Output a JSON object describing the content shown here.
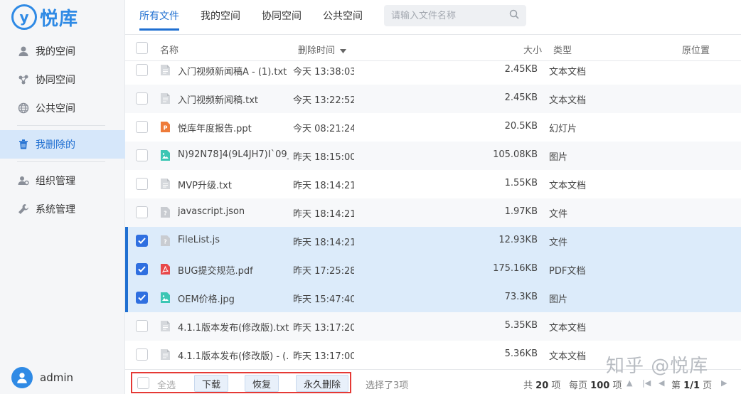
{
  "app": {
    "logo_mark": "y",
    "logo_text": "悦库"
  },
  "sidebar": {
    "items": [
      {
        "label": "我的空间",
        "icon": "user-icon"
      },
      {
        "label": "协同空间",
        "icon": "share-icon"
      },
      {
        "label": "公共空间",
        "icon": "globe-icon"
      },
      {
        "label": "我删除的",
        "icon": "trash-icon",
        "active": true
      },
      {
        "label": "组织管理",
        "icon": "org-icon"
      },
      {
        "label": "系统管理",
        "icon": "wrench-icon"
      }
    ],
    "user": {
      "name": "admin"
    }
  },
  "tabs": [
    {
      "label": "所有文件",
      "active": true
    },
    {
      "label": "我的空间"
    },
    {
      "label": "协同空间"
    },
    {
      "label": "公共空间"
    }
  ],
  "search": {
    "placeholder": "请输入文件名称"
  },
  "table": {
    "headers": {
      "name": "名称",
      "deleted_time": "删除时间",
      "size": "大小",
      "type": "类型",
      "origin": "原位置"
    },
    "rows": [
      {
        "name": "入门视频新闻稿A - (1).txt",
        "time": "今天 13:38:03",
        "size": "2.45KB",
        "type": "文本文档",
        "kind": "txt",
        "selected": false
      },
      {
        "name": "入门视频新闻稿.txt",
        "time": "今天 13:22:52",
        "size": "2.45KB",
        "type": "文本文档",
        "kind": "txt",
        "selected": false
      },
      {
        "name": "悦库年度报告.ppt",
        "time": "今天 08:21:24",
        "size": "20.5KB",
        "type": "幻灯片",
        "kind": "ppt",
        "selected": false
      },
      {
        "name": "N)92N78]4(9L4JH7)I`09_...",
        "time": "昨天 18:15:00",
        "size": "105.08KB",
        "type": "图片",
        "kind": "img",
        "selected": false
      },
      {
        "name": "MVP升级.txt",
        "time": "昨天 18:14:21",
        "size": "1.55KB",
        "type": "文本文档",
        "kind": "txt",
        "selected": false
      },
      {
        "name": "javascript.json",
        "time": "昨天 18:14:21",
        "size": "1.97KB",
        "type": "文件",
        "kind": "unknown",
        "selected": false
      },
      {
        "name": "FileList.js",
        "time": "昨天 18:14:21",
        "size": "12.93KB",
        "type": "文件",
        "kind": "unknown",
        "selected": true
      },
      {
        "name": "BUG提交规范.pdf",
        "time": "昨天 17:25:28",
        "size": "175.16KB",
        "type": "PDF文档",
        "kind": "pdf",
        "selected": true
      },
      {
        "name": "OEM价格.jpg",
        "time": "昨天 15:47:40",
        "size": "73.3KB",
        "type": "图片",
        "kind": "img",
        "selected": true
      },
      {
        "name": "4.1.1版本发布(修改版).txt",
        "time": "昨天 13:17:20",
        "size": "5.35KB",
        "type": "文本文档",
        "kind": "txt",
        "selected": false
      },
      {
        "name": "4.1.1版本发布(修改版) - (...",
        "time": "昨天 13:17:00",
        "size": "5.36KB",
        "type": "文本文档",
        "kind": "txt",
        "selected": false
      }
    ]
  },
  "footer": {
    "select_all": "全选",
    "download": "下载",
    "restore": "恢复",
    "delete_forever": "永久删除",
    "selected_text": "选择了3项",
    "total_prefix": "共",
    "total": "20",
    "total_suffix": "项",
    "per_page_prefix": "每页",
    "per_page": "100",
    "per_page_suffix": "项",
    "page_prefix": "第",
    "page": "1/1",
    "page_suffix": "页"
  },
  "watermark": "知乎 @悦库",
  "colors": {
    "accent": "#1f6fd1",
    "selected_row": "#dcebfa",
    "highlight_box": "#e53935"
  }
}
